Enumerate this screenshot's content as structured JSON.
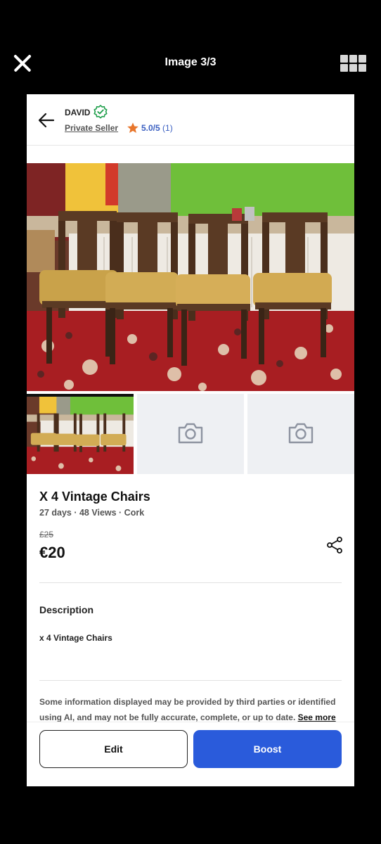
{
  "viewer": {
    "close_icon": "close-icon",
    "counter": "Image 3/3",
    "grid_icon": "grid-view-icon"
  },
  "seller": {
    "name": "DAVID",
    "verified_icon": "verified-badge-icon",
    "type": "Private Seller",
    "rating": "5.0/5",
    "rating_count": "(1)",
    "star_color": "#e8762c"
  },
  "gallery": {
    "main_image": "four vintage wooden chairs with mustard leather seats on a red floral carpet",
    "thumbnails": [
      {
        "kind": "photo"
      },
      {
        "kind": "placeholder",
        "icon": "camera-icon"
      },
      {
        "kind": "placeholder",
        "icon": "camera-icon"
      }
    ]
  },
  "listing": {
    "title": "X 4 Vintage Chairs",
    "meta": "27 days · 48 Views · Cork",
    "old_price": "£25",
    "price": "€20",
    "share_icon": "share-icon"
  },
  "description": {
    "heading": "Description",
    "text": "x 4 Vintage Chairs"
  },
  "disclaimer": {
    "text": "Some information displayed may be provided by third parties or identified using AI, and may not be fully accurate, complete, or up to date. ",
    "link": "See more"
  },
  "actions": {
    "edit_label": "Edit",
    "boost_label": "Boost",
    "boost_color": "#2a5bdb"
  }
}
